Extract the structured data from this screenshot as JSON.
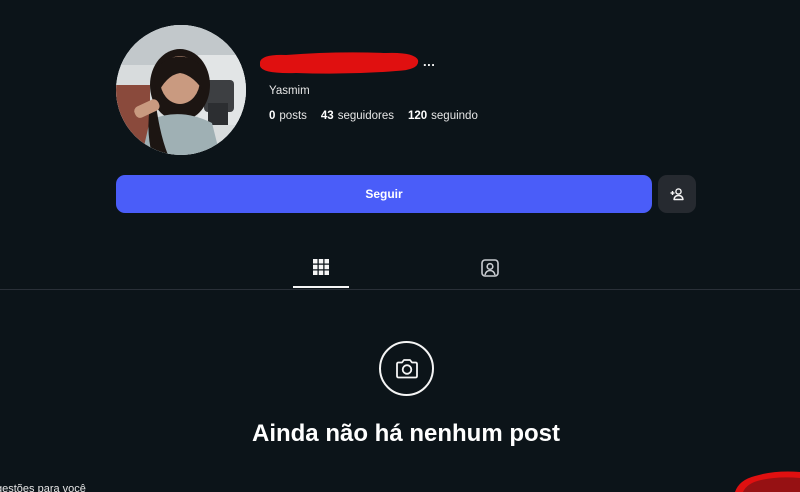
{
  "profile": {
    "display_name": "Yasmim",
    "username_suffix": "...",
    "stats": [
      {
        "value": "0",
        "label": "posts"
      },
      {
        "value": "43",
        "label": "seguidores"
      },
      {
        "value": "120",
        "label": "seguindo"
      }
    ]
  },
  "actions": {
    "follow_label": "Seguir"
  },
  "tabs": [
    {
      "icon": "grid-icon",
      "active": true
    },
    {
      "icon": "tagged-icon",
      "active": false
    }
  ],
  "empty_state": {
    "icon": "camera-icon",
    "title": "Ainda não há nenhum post"
  },
  "footer": {
    "suggestions_text": "gestões para você"
  },
  "colors": {
    "background": "#0c1419",
    "follow_button": "#4a5df9",
    "secondary_button": "#262a30",
    "redaction": "#e01010"
  }
}
